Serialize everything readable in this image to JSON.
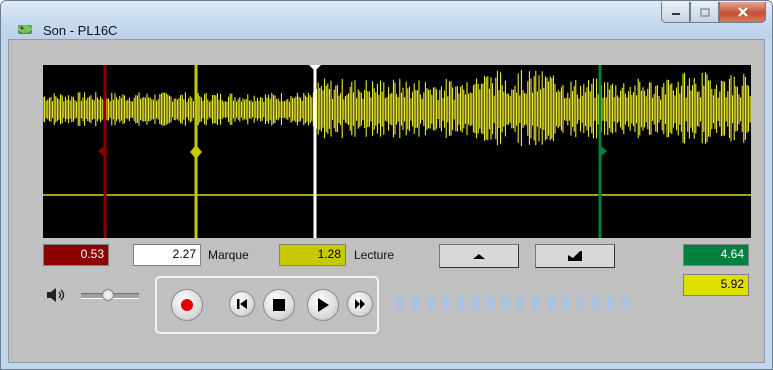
{
  "window": {
    "title": "Son - PL16C"
  },
  "controls": {
    "cursor_red_value": "0.53",
    "marque_value": "2.27",
    "marque_label": "Marque",
    "lecture_value": "1.28",
    "lecture_label": "Lecture",
    "green_value": "4.64",
    "total_value": "5.92"
  },
  "volume": {
    "level": 0.45
  },
  "colors": {
    "red_marker": "#8b0000",
    "yellow_marker": "#c8c800",
    "green_marker": "#008040",
    "waveform": "#ffff33"
  },
  "icons": [
    "app-icon",
    "minimize-icon",
    "maximize-icon",
    "close-icon",
    "speaker-icon",
    "record-icon",
    "skip-start-icon",
    "stop-icon",
    "play-icon",
    "fast-forward-icon"
  ]
}
